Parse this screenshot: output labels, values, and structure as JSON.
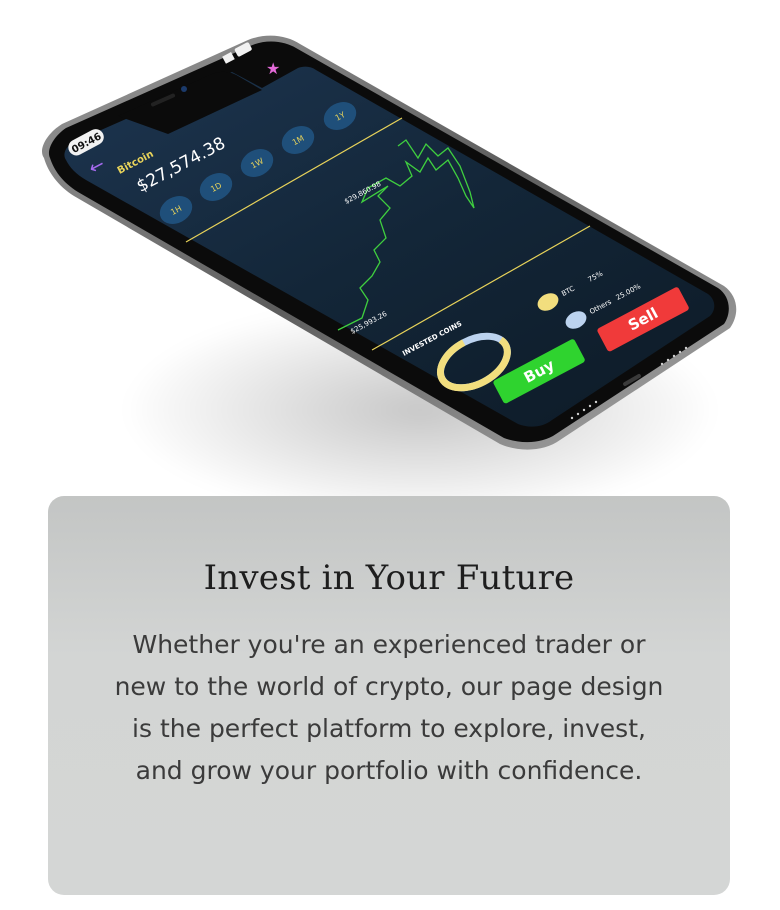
{
  "phone": {
    "status_time": "09:46",
    "coin_name": "Bitcoin",
    "price": "$27,574.38",
    "ranges": [
      "1H",
      "1D",
      "1W",
      "1M",
      "1Y"
    ],
    "chart_high": "$29,860.98",
    "chart_low": "$25,993.26",
    "invested_label": "INVESTED COINS",
    "legend": [
      {
        "name": "BTC",
        "pct": "75%",
        "color": "#f2de7e"
      },
      {
        "name": "Others",
        "pct": "25.00%",
        "color": "#bcd3ef"
      }
    ],
    "buy_label": "Buy",
    "sell_label": "Sell",
    "colors": {
      "accent_line": "#e8d35a",
      "chart_line": "#3fcf3f",
      "buy": "#2fd32f",
      "sell": "#f03a3a",
      "back_arrow": "#a66bf0",
      "star": "#e36ad8"
    }
  },
  "card": {
    "title": "Invest in Your Future",
    "body": "Whether you're an experienced trader or new to the world of crypto, our page design is the perfect platform to explore, invest, and grow your portfolio with confidence."
  }
}
